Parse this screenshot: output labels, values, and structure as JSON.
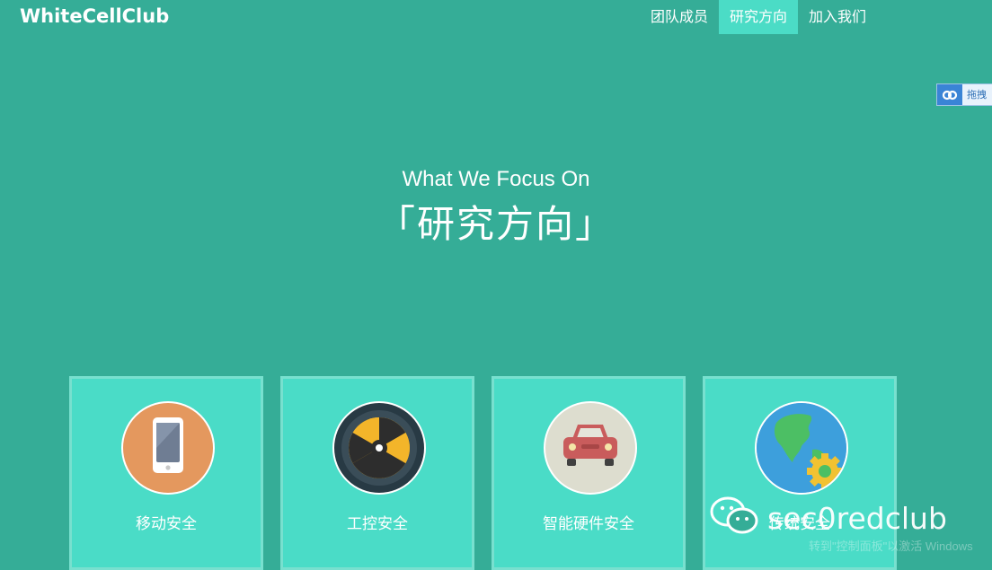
{
  "brand": {
    "name": "WhiteCellClub"
  },
  "nav": {
    "items": [
      {
        "label": "团队成员",
        "active": false
      },
      {
        "label": "研究方向",
        "active": true
      },
      {
        "label": "加入我们",
        "active": false
      }
    ]
  },
  "share_widget": {
    "label": "拖拽",
    "icon": "baidu-share-icon"
  },
  "hero": {
    "subtitle": "What We Focus On",
    "title": "「研究方向」"
  },
  "focus_cards": [
    {
      "label": "移动安全",
      "icon": "smartphone-icon",
      "circle_color": "#e4985e"
    },
    {
      "label": "工控安全",
      "icon": "radiation-icon",
      "circle_color": "#283a44"
    },
    {
      "label": "智能硬件安全",
      "icon": "car-icon",
      "circle_color": "#ddddcf"
    },
    {
      "label": "传统安全",
      "icon": "globe-gear-icon",
      "circle_color": "#3d9fdc"
    }
  ],
  "watermark": {
    "text": "sec0redclub",
    "icon": "wechat-icon"
  },
  "system_overlay": {
    "text": "转到\"控制面板\"以激活 Windows"
  },
  "colors": {
    "background": "#35ad97",
    "nav_active": "#4bdcc6",
    "card": "#4adcc7",
    "card_border": "#78e0cf"
  }
}
